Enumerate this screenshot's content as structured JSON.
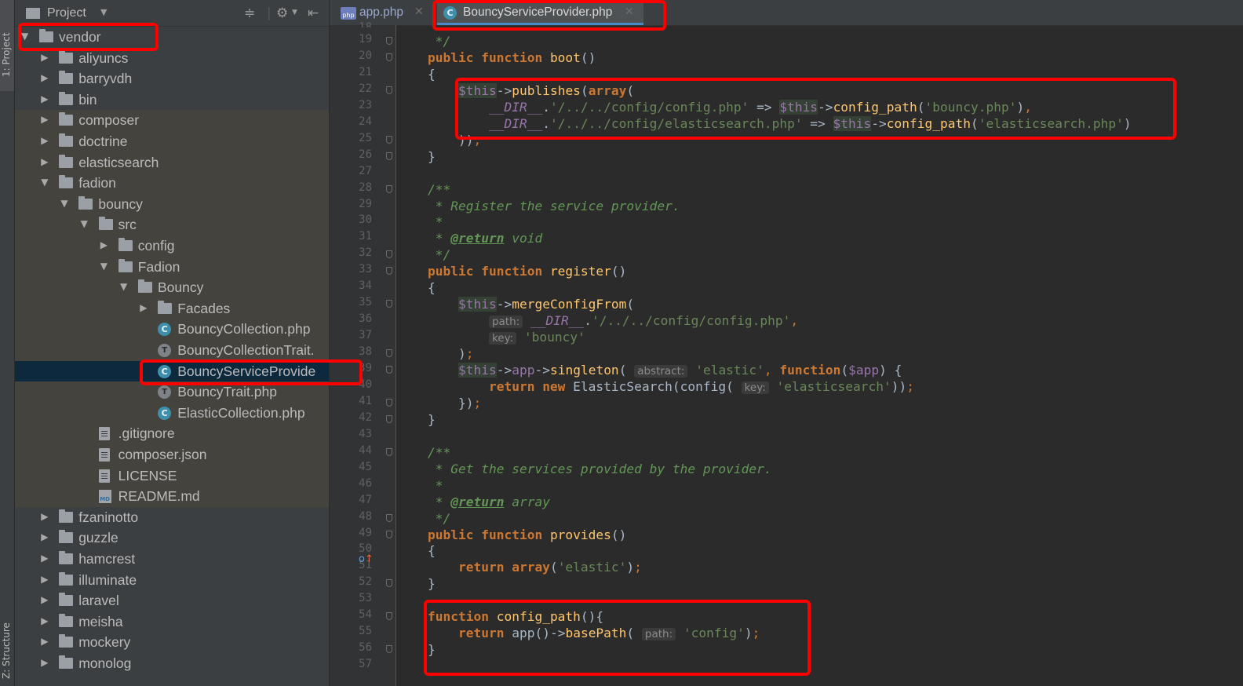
{
  "toolstrip": {
    "project_tab": "1: Project",
    "structure_tab": "Z: Structure"
  },
  "project_panel": {
    "title": "Project",
    "tree": [
      {
        "label": "vendor",
        "type": "folder",
        "depth": 0,
        "expanded": true
      },
      {
        "label": "aliyuncs",
        "type": "folder",
        "depth": 1,
        "expanded": false
      },
      {
        "label": "barryvdh",
        "type": "folder",
        "depth": 1,
        "expanded": false
      },
      {
        "label": "bin",
        "type": "folder",
        "depth": 1,
        "expanded": false
      },
      {
        "label": "composer",
        "type": "folder",
        "depth": 1,
        "expanded": false
      },
      {
        "label": "doctrine",
        "type": "folder",
        "depth": 1,
        "expanded": false
      },
      {
        "label": "elasticsearch",
        "type": "folder",
        "depth": 1,
        "expanded": false
      },
      {
        "label": "fadion",
        "type": "folder",
        "depth": 1,
        "expanded": true
      },
      {
        "label": "bouncy",
        "type": "folder",
        "depth": 2,
        "expanded": true
      },
      {
        "label": "src",
        "type": "folder",
        "depth": 3,
        "expanded": true
      },
      {
        "label": "config",
        "type": "folder",
        "depth": 4,
        "expanded": false
      },
      {
        "label": "Fadion",
        "type": "folder",
        "depth": 4,
        "expanded": true
      },
      {
        "label": "Bouncy",
        "type": "folder",
        "depth": 5,
        "expanded": true
      },
      {
        "label": "Facades",
        "type": "folder",
        "depth": 6,
        "expanded": false
      },
      {
        "label": "BouncyCollection.php",
        "type": "class",
        "depth": 6
      },
      {
        "label": "BouncyCollectionTrait.",
        "type": "trait",
        "depth": 6
      },
      {
        "label": "BouncyServiceProvide",
        "type": "class",
        "depth": 6,
        "selected": true
      },
      {
        "label": "BouncyTrait.php",
        "type": "trait",
        "depth": 6
      },
      {
        "label": "ElasticCollection.php",
        "type": "class",
        "depth": 6
      },
      {
        "label": ".gitignore",
        "type": "file",
        "depth": 3
      },
      {
        "label": "composer.json",
        "type": "file",
        "depth": 3
      },
      {
        "label": "LICENSE",
        "type": "file",
        "depth": 3
      },
      {
        "label": "README.md",
        "type": "md",
        "depth": 3
      },
      {
        "label": "fzaninotto",
        "type": "folder",
        "depth": 1,
        "expanded": false
      },
      {
        "label": "guzzle",
        "type": "folder",
        "depth": 1,
        "expanded": false
      },
      {
        "label": "hamcrest",
        "type": "folder",
        "depth": 1,
        "expanded": false
      },
      {
        "label": "illuminate",
        "type": "folder",
        "depth": 1,
        "expanded": false
      },
      {
        "label": "laravel",
        "type": "folder",
        "depth": 1,
        "expanded": false
      },
      {
        "label": "meisha",
        "type": "folder",
        "depth": 1,
        "expanded": false
      },
      {
        "label": "mockery",
        "type": "folder",
        "depth": 1,
        "expanded": false
      },
      {
        "label": "monolog",
        "type": "folder",
        "depth": 1,
        "expanded": false
      }
    ]
  },
  "tabs": [
    {
      "label": "app.php",
      "active": false
    },
    {
      "label": "BouncyServiceProvider.php",
      "active": true
    }
  ],
  "editor": {
    "line_numbers": [
      "19",
      "20",
      "21",
      "22",
      "23",
      "24",
      "25",
      "26",
      "27",
      "28",
      "29",
      "30",
      "31",
      "32",
      "33",
      "34",
      "35",
      "36",
      "37",
      "38",
      "39",
      "40",
      "41",
      "42",
      "43",
      "44",
      "45",
      "46",
      "47",
      "48",
      "49",
      "50",
      "51",
      "52",
      "53",
      "54",
      "55",
      "56",
      "57"
    ],
    "hints": {
      "path": "path:",
      "key": "key:",
      "abstract": "abstract:"
    }
  },
  "colors": {
    "annotation": "#ff0000",
    "keyword": "#cc7832",
    "function": "#ffc66d",
    "string": "#6a8759",
    "variable": "#9876aa",
    "comment": "#629755"
  }
}
